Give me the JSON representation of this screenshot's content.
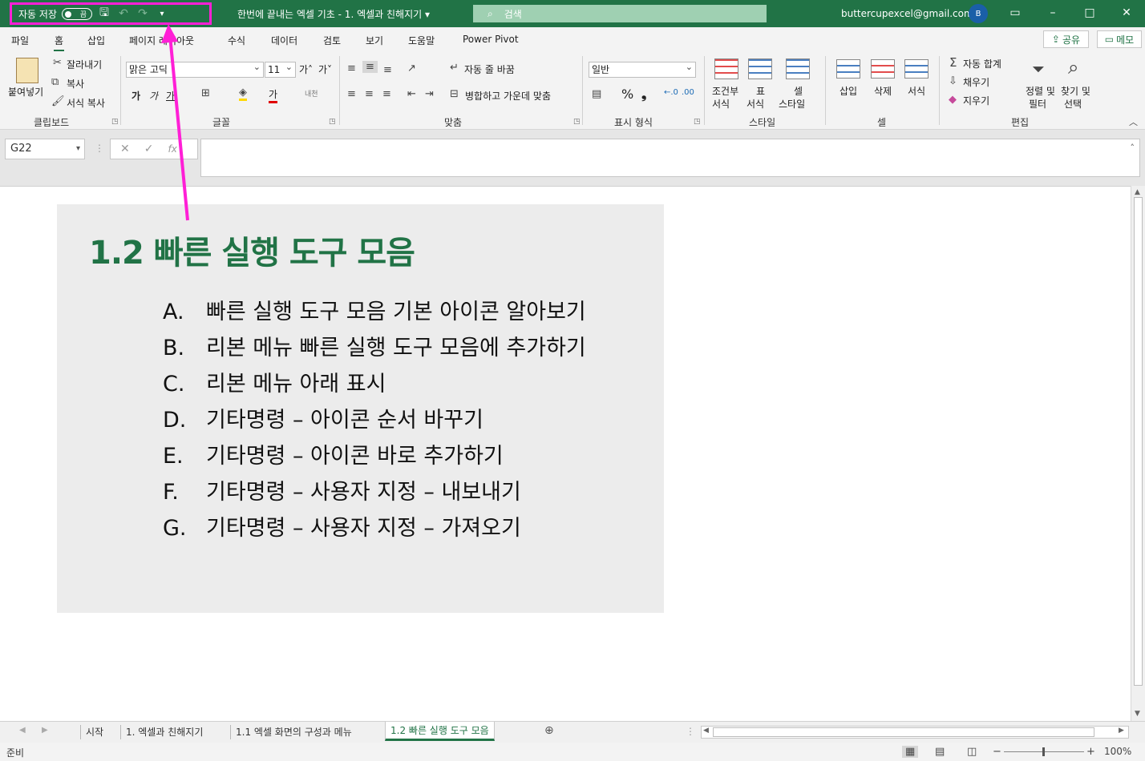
{
  "titlebar": {
    "autosave_label": "자동 저장",
    "autosave_state": "끔",
    "doc_title": "한번에 끝내는 엑셀 기초 - 1. 엑셀과 친해지기 ▾",
    "search_placeholder": "검색",
    "account_email": "buttercupexcel@gmail.com",
    "avatar_initial": "B"
  },
  "tabs": [
    "파일",
    "홈",
    "삽입",
    "페이지 레이아웃",
    "수식",
    "데이터",
    "검토",
    "보기",
    "도움말",
    "Power Pivot"
  ],
  "active_tab": "홈",
  "share_label": "공유",
  "memo_label": "메모",
  "ribbon": {
    "clipboard": {
      "paste": "붙여넣기",
      "cut": "잘라내기",
      "copy": "복사",
      "format_painter": "서식 복사",
      "group": "클립보드"
    },
    "font": {
      "font_name": "맑은 고딕",
      "font_size": "11",
      "group": "글꼴"
    },
    "alignment": {
      "wrap": "자동 줄 바꿈",
      "merge": "병합하고 가운데 맞춤",
      "group": "맞춤"
    },
    "number": {
      "format": "일반",
      "group": "표시 형식"
    },
    "styles": {
      "conditional_1": "조건부",
      "conditional_2": "서식",
      "table_1": "표",
      "table_2": "서식",
      "cell_1": "셀",
      "cell_2": "스타일",
      "group": "스타일"
    },
    "cells": {
      "insert": "삽입",
      "delete": "삭제",
      "format": "서식",
      "group": "셀"
    },
    "editing": {
      "autosum": "자동 합계",
      "fill": "채우기",
      "clear": "지우기",
      "sort_1": "정렬 및",
      "sort_2": "필터",
      "find_1": "찾기 및",
      "find_2": "선택",
      "group": "편집"
    }
  },
  "formula_bar": {
    "name_box": "G22",
    "fx": "fx",
    "content": ""
  },
  "slide": {
    "title": "1.2 빠른 실행 도구 모음",
    "items": [
      {
        "letter": "A.",
        "text": "빠른 실행 도구 모음 기본 아이콘 알아보기"
      },
      {
        "letter": "B.",
        "text": "리본 메뉴 빠른 실행 도구 모음에 추가하기"
      },
      {
        "letter": "C.",
        "text": "리본 메뉴 아래 표시"
      },
      {
        "letter": "D.",
        "text": "기타명령 – 아이콘 순서 바꾸기"
      },
      {
        "letter": "E.",
        "text": "기타명령 – 아이콘 바로 추가하기"
      },
      {
        "letter": "F.",
        "text": "기타명령 – 사용자 지정 – 내보내기"
      },
      {
        "letter": "G.",
        "text": "기타명령 – 사용자 지정 – 가져오기"
      }
    ]
  },
  "sheet_tabs": [
    "시작",
    "1. 엑셀과 친해지기",
    "1.1 엑셀 화면의 구성과 메뉴",
    "1.2 빠른 실행 도구 모음"
  ],
  "active_sheet": "1.2 빠른 실행 도구 모음",
  "status": {
    "ready": "준비",
    "zoom": "100%"
  },
  "colors": {
    "brand": "#217346",
    "highlight": "#ff1fd6",
    "slide_bg": "#ececec"
  }
}
